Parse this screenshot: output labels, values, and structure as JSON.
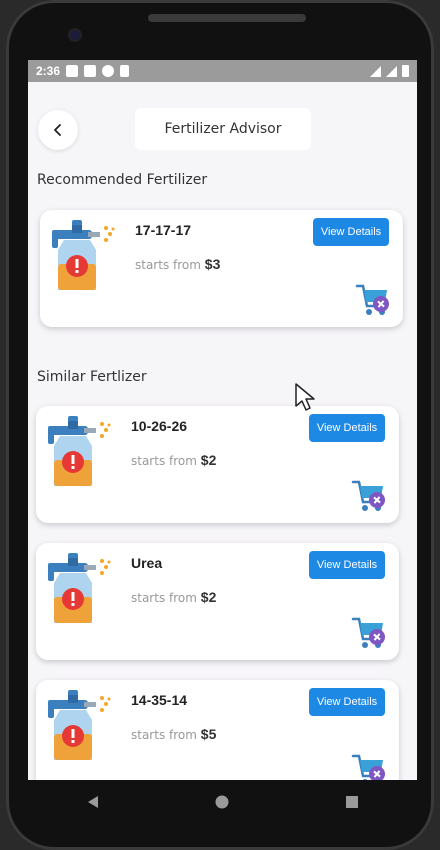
{
  "status_bar": {
    "time": "2:36"
  },
  "header": {
    "title": "Fertilizer Advisor"
  },
  "recommended": {
    "label": "Recommended Fertilizer",
    "item": {
      "name": "17-17-17",
      "price_prefix": "starts from",
      "price": "$3",
      "button": "View Details"
    }
  },
  "similar": {
    "label": "Similar Fertlizer",
    "items": [
      {
        "name": "10-26-26",
        "price_prefix": "starts from",
        "price": "$2",
        "button": "View Details"
      },
      {
        "name": "Urea",
        "price_prefix": "starts from",
        "price": "$2",
        "button": "View Details"
      },
      {
        "name": "14-35-14",
        "price_prefix": "starts from",
        "price": "$5",
        "button": "View Details"
      }
    ]
  },
  "icons": {
    "product": "fertilizer-sprayer-icon",
    "cart": "add-to-cart-icon",
    "back": "back-arrow-icon"
  },
  "colors": {
    "primary": "#1e88e5",
    "background": "#f6f5f8"
  }
}
